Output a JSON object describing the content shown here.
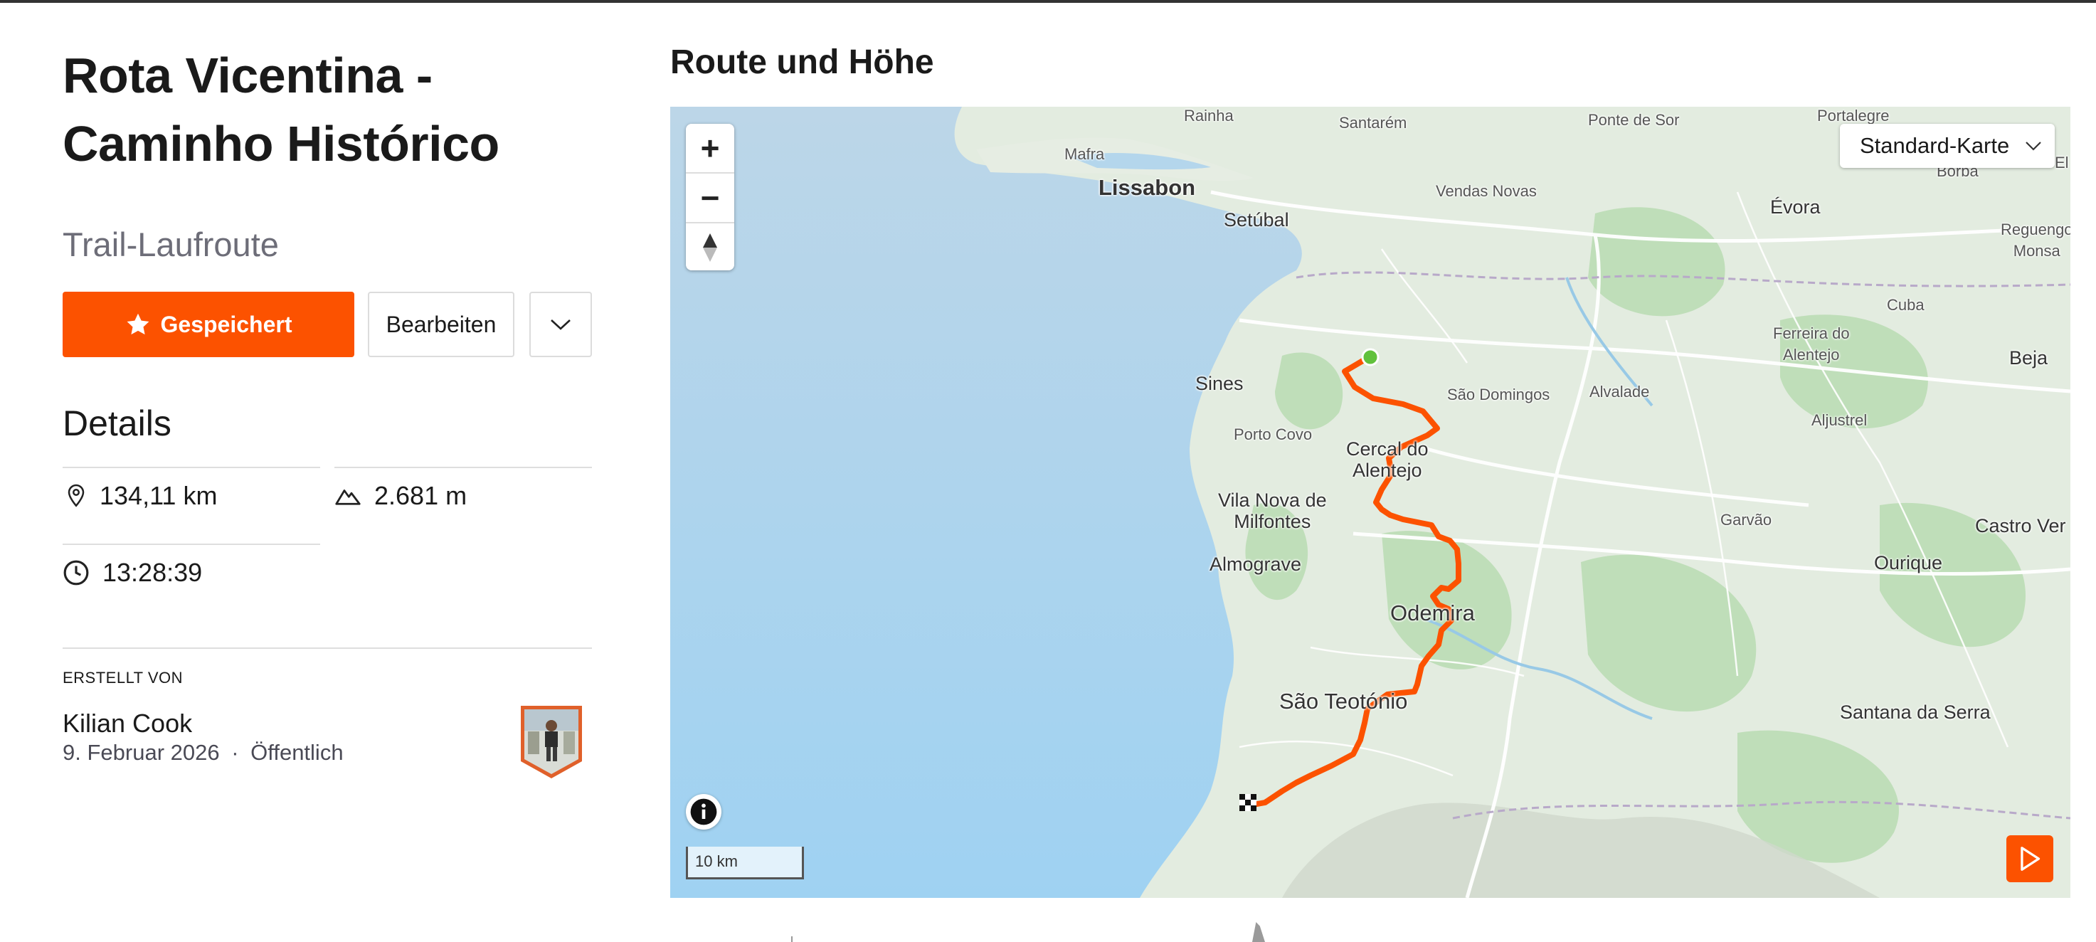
{
  "route": {
    "title": "Rota Vicentina - Caminho Histórico",
    "type": "Trail-Laufroute"
  },
  "actions": {
    "saved_label": "Gespeichert",
    "edit_label": "Bearbeiten"
  },
  "details": {
    "heading": "Details",
    "distance": "134,11 km",
    "elevation": "2.681 m",
    "time": "13:28:39"
  },
  "creator": {
    "label": "ERSTELLT VON",
    "name": "Kilian Cook",
    "date": "9. Februar 2026",
    "separator": "·",
    "visibility": "Öffentlich"
  },
  "map": {
    "heading": "Route und Höhe",
    "style_select": "Standard-Karte",
    "scale": "10 km",
    "zoom_in": "+",
    "zoom_out": "−",
    "labels": {
      "rainha": "Rainha",
      "santarem": "Santarém",
      "ponte_de_sor": "Ponte de Sor",
      "portalegre": "Portalegre",
      "mafra": "Mafra",
      "lissabon": "Lissabon",
      "vendas_novas": "Vendas Novas",
      "borba": "Borba",
      "setubal": "Setúbal",
      "evora": "Évora",
      "reguengos_1": "Reguengo",
      "reguengos_2": "Monsa",
      "cuba": "Cuba",
      "ferreira_1": "Ferreira do",
      "ferreira_2": "Alentejo",
      "beja": "Beja",
      "sines": "Sines",
      "sao_domingos": "São Domingos",
      "alvalade": "Alvalade",
      "aljustrel": "Aljustrel",
      "porto_covo": "Porto Covo",
      "cercal_1": "Cercal do",
      "cercal_2": "Alentejo",
      "vila_nova_1": "Vila Nova de",
      "vila_nova_2": "Milfontes",
      "garvao": "Garvão",
      "castro_verde": "Castro Ver",
      "almograve": "Almograve",
      "ourique": "Ourique",
      "odemira": "Odemira",
      "sao_teotonio": "São Teotónio",
      "santana": "Santana da Serra",
      "el": "El"
    }
  }
}
